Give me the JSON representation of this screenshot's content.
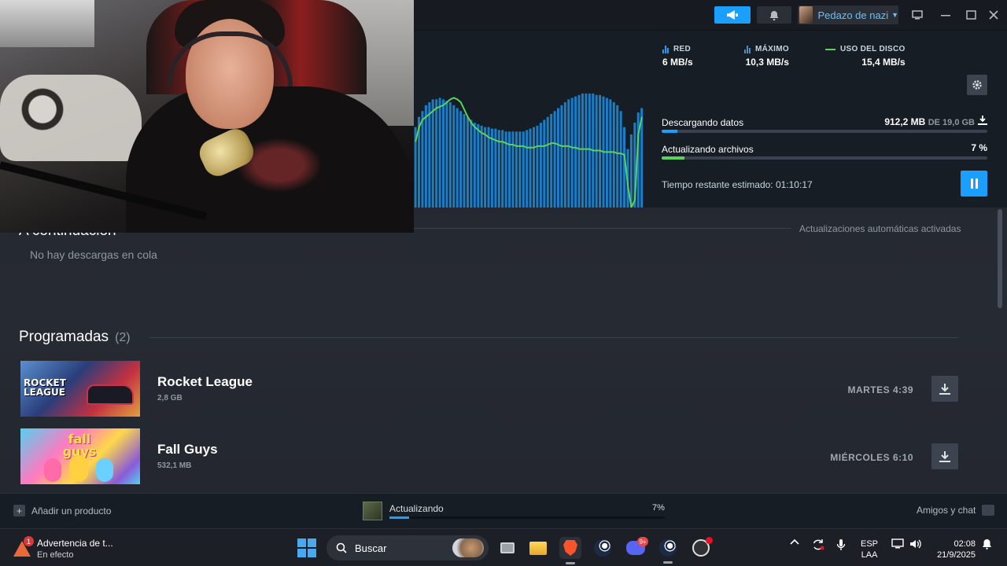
{
  "titlebar": {
    "profile_name": "Pedazo de nazi",
    "icons": [
      "megaphone-icon",
      "bell-icon",
      "big-picture-icon",
      "minimize-icon",
      "maximize-icon",
      "close-icon"
    ]
  },
  "download": {
    "stats": {
      "red_label": "RED",
      "red_value": "6 MB/s",
      "max_label": "MÁXIMO",
      "max_value": "10,3 MB/s",
      "disk_label": "USO DEL DISCO",
      "disk_value": "15,4 MB/s"
    },
    "data_label": "Descargando datos",
    "data_done": "912,2 MB",
    "data_of": "DE 19,0 GB",
    "data_fraction": 0.048,
    "files_label": "Actualizando archivos",
    "files_pct": "7 %",
    "files_fraction": 0.07,
    "eta": "Tiempo restante estimado: 01:10:17",
    "colors": {
      "accent": "#1a9fff",
      "disk_line": "#5ad35a"
    },
    "graph": {
      "network_series": [
        0.55,
        0.62,
        0.66,
        0.7,
        0.72,
        0.74,
        0.74,
        0.75,
        0.74,
        0.73,
        0.72,
        0.7,
        0.68,
        0.66,
        0.64,
        0.62,
        0.6,
        0.58,
        0.57,
        0.56,
        0.55,
        0.55,
        0.54,
        0.54,
        0.53,
        0.53,
        0.52,
        0.52,
        0.52,
        0.52,
        0.52,
        0.52,
        0.53,
        0.54,
        0.55,
        0.56,
        0.58,
        0.6,
        0.62,
        0.64,
        0.66,
        0.68,
        0.7,
        0.72,
        0.74,
        0.75,
        0.76,
        0.77,
        0.78,
        0.78,
        0.78,
        0.78,
        0.77,
        0.77,
        0.76,
        0.75,
        0.74,
        0.72,
        0.7,
        0.66,
        0.55,
        0.4,
        0.5,
        0.58,
        0.65,
        0.68
      ],
      "disk_series": [
        0.45,
        0.55,
        0.6,
        0.62,
        0.64,
        0.66,
        0.68,
        0.69,
        0.7,
        0.72,
        0.74,
        0.75,
        0.74,
        0.72,
        0.67,
        0.62,
        0.58,
        0.55,
        0.53,
        0.51,
        0.5,
        0.48,
        0.47,
        0.46,
        0.45,
        0.45,
        0.44,
        0.43,
        0.43,
        0.42,
        0.42,
        0.42,
        0.41,
        0.41,
        0.41,
        0.42,
        0.42,
        0.42,
        0.43,
        0.44,
        0.44,
        0.43,
        0.42,
        0.42,
        0.42,
        0.41,
        0.41,
        0.4,
        0.4,
        0.4,
        0.4,
        0.39,
        0.39,
        0.39,
        0.38,
        0.38,
        0.38,
        0.38,
        0.37,
        0.37,
        0.36,
        0.15,
        0.0,
        0.05,
        0.5,
        0.62
      ]
    }
  },
  "queue": {
    "heading": "A continuación",
    "empty_text": "No hay descargas en cola",
    "auto_updates": "Actualizaciones automáticas activadas"
  },
  "scheduled": {
    "heading": "Programadas",
    "count": "(2)",
    "games": [
      {
        "title": "Rocket League",
        "size": "2,8 GB",
        "schedule": "MARTES 4:39",
        "cover_text": "ROCKET LEAGUE"
      },
      {
        "title": "Fall Guys",
        "size": "532,1 MB",
        "schedule": "MIÉRCOLES 6:10",
        "cover_text": "fall guys"
      }
    ]
  },
  "footer": {
    "add_product": "Añadir un producto",
    "status": "Actualizando",
    "pct": "7%",
    "fraction": 0.07,
    "friends_chat": "Amigos y chat"
  },
  "taskbar": {
    "alert_title": "Advertencia de t...",
    "alert_sub": "En efecto",
    "alert_badge": "1",
    "search_label": "Buscar",
    "discord_badge": "9+",
    "lang_top": "ESP",
    "lang_bottom": "LAA",
    "time": "02:08",
    "date": "21/9/2025"
  }
}
